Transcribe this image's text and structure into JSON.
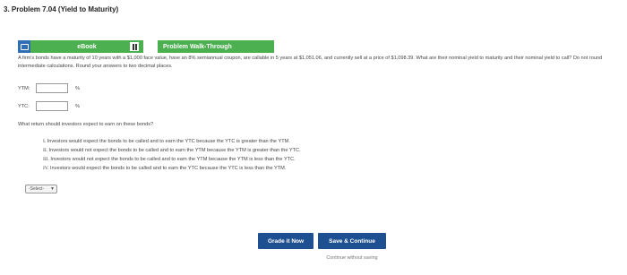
{
  "header": {
    "title": "3. Problem 7.04 (Yield to Maturity)"
  },
  "tabs": [
    {
      "label": "eBook",
      "icon": "book-icon"
    },
    {
      "label": "Problem Walk-Through",
      "icon": "video-icon"
    }
  ],
  "problem": {
    "text": "A firm's bonds have a maturity of 10 years with a $1,000 face value, have an 8% semiannual coupon, are callable in 5 years at $1,051.06, and currently sell at a price of $1,098.39. What are their nominal yield to maturity and their nominal yield to call? Do not round intermediate calculations. Round your answers to two decimal places."
  },
  "fields": [
    {
      "label": "YTM:",
      "value": "",
      "unit": "%"
    },
    {
      "label": "YTC:",
      "value": "",
      "unit": "%"
    }
  ],
  "question": "What return should investors expect to earn on these bonds?",
  "choices": [
    {
      "num": "I.",
      "text": "Investors would expect the bonds to be called and to earn the YTC because the YTC is greater than the YTM."
    },
    {
      "num": "II.",
      "text": "Investors would not expect the bonds to be called and to earn the YTM because the YTM is greater than the YTC."
    },
    {
      "num": "III.",
      "text": "Investors would not expect the bonds to be called and to earn the YTM because the YTM is less than the YTC."
    },
    {
      "num": "IV.",
      "text": "Investors would expect the bonds to be called and to earn the YTC because the YTC is less than the YTM."
    }
  ],
  "select": {
    "value": "-Select-"
  },
  "buttons": {
    "grade": "Grade it Now",
    "save": "Save & Continue",
    "continue": "Continue without saving"
  }
}
